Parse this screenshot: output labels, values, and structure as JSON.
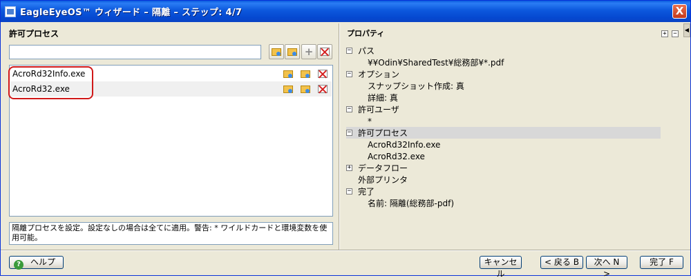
{
  "window": {
    "title": "EagleEyeOS™ ウィザード – 隔離 – ステップ: 4/7",
    "close": "X"
  },
  "left": {
    "title": "許可プロセス",
    "input_value": "",
    "processes": [
      "AcroRd32Info.exe",
      "AcroRd32.exe"
    ],
    "description": "隔離プロセスを設定。設定なしの場合は全てに適用。警告: * ワイルドカードと環境変数を使用可能。"
  },
  "right": {
    "title": "プロパティ",
    "expand_all": "+",
    "collapse_all": "−",
    "tree": {
      "path_label": "パス",
      "path_value": "¥¥Odin¥SharedTest¥総務部¥*.pdf",
      "options_label": "オプション",
      "snapshot": "スナップショット作成: 真",
      "detail": "詳細: 真",
      "users_label": "許可ユーザ",
      "users_value": "*",
      "process_label": "許可プロセス",
      "process_1": "AcroRd32Info.exe",
      "process_2": "AcroRd32.exe",
      "dataflow_label": "データフロー",
      "printer_label": "外部プリンタ",
      "done_label": "完了",
      "name_value": "名前: 隔離(総務部-pdf)"
    }
  },
  "buttons": {
    "help": "ヘルプ",
    "cancel": "キャンセル",
    "back": "< 戻る B",
    "next": "次へ N >",
    "finish": "完了 F"
  }
}
